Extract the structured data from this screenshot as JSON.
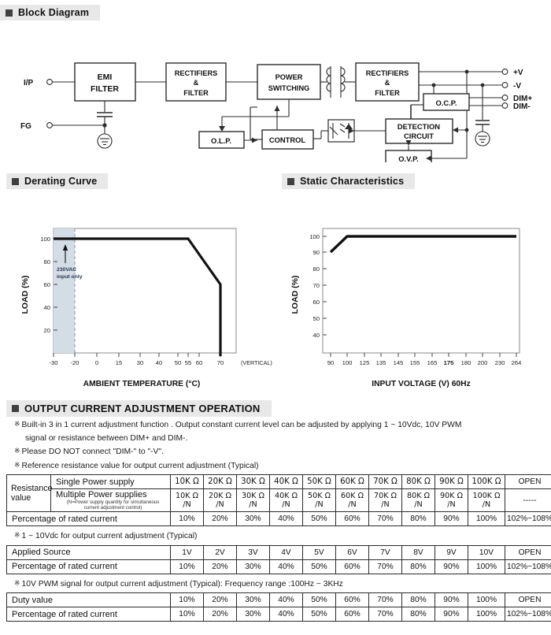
{
  "sections": {
    "block_diagram": {
      "title": "Block Diagram"
    },
    "derating": {
      "title": "Derating Curve"
    },
    "static": {
      "title": "Static Characteristics"
    },
    "adjust": {
      "title": "OUTPUT CURRENT ADJUSTMENT OPERATION"
    }
  },
  "block_diagram": {
    "inputs": [
      "I/P",
      "FG"
    ],
    "blocks": [
      "EMI\nFILTER",
      "RECTIFIERS\n&\nFILTER",
      "POWER\nSWITCHING",
      "RECTIFIERS\n&\nFILTER",
      "O.L.P.",
      "CONTROL",
      "O.C.P.",
      "DETECTION\nCIRCUIT",
      "O.V.P."
    ],
    "block_labels": {
      "emi_filter_l1": "EMI",
      "emi_filter_l2": "FILTER",
      "rect1_l1": "RECTIFIERS",
      "rect1_l2": "&",
      "rect1_l3": "FILTER",
      "power_l1": "POWER",
      "power_l2": "SWITCHING",
      "rect2_l1": "RECTIFIERS",
      "rect2_l2": "&",
      "rect2_l3": "FILTER",
      "olp": "O.L.P.",
      "control": "CONTROL",
      "ocp": "O.C.P.",
      "detect_l1": "DETECTION",
      "detect_l2": "CIRCUIT",
      "ovp": "O.V.P."
    },
    "outputs": [
      "+V",
      "-V",
      "DIM+",
      "DIM-"
    ]
  },
  "chart_data": [
    {
      "type": "line",
      "name": "derating-curve",
      "title": "Derating Curve",
      "xlabel": "AMBIENT TEMPERATURE (°C)",
      "ylabel": "LOAD (%)",
      "xticks": [
        -30,
        -20,
        0,
        15,
        30,
        40,
        50,
        55,
        60,
        70
      ],
      "yticks": [
        20,
        40,
        60,
        80,
        100
      ],
      "xlim": [
        -30,
        75
      ],
      "ylim": [
        0,
        110
      ],
      "grid": false,
      "annotations": [
        {
          "text": "230VAC",
          "x": -26,
          "y": 72
        },
        {
          "text": "input only",
          "x": -26,
          "y": 64
        },
        {
          "text": "(VERTICAL)",
          "x": 78,
          "y": -6
        }
      ],
      "shaded_region": {
        "from": -30,
        "to": -20,
        "color": "#d4dde6"
      },
      "series": [
        {
          "name": "Load vs ambient temperature",
          "points": [
            {
              "x": -30,
              "y": 100
            },
            {
              "x": 55,
              "y": 100
            },
            {
              "x": 70,
              "y": 60
            },
            {
              "x": 70,
              "y": 0
            }
          ]
        }
      ]
    },
    {
      "type": "line",
      "name": "static-characteristics",
      "title": "Static Characteristics",
      "xlabel": "INPUT VOLTAGE (V) 60Hz",
      "ylabel": "LOAD (%)",
      "xticks": [
        90,
        100,
        125,
        135,
        145,
        155,
        165,
        175,
        180,
        200,
        230,
        264
      ],
      "xtick_bold": [
        175
      ],
      "yticks": [
        40,
        50,
        60,
        70,
        80,
        90,
        100
      ],
      "ylim": [
        30,
        108
      ],
      "grid": false,
      "series": [
        {
          "name": "Load vs input voltage",
          "points": [
            {
              "x": 90,
              "y": 90
            },
            {
              "x": 100,
              "y": 100
            },
            {
              "x": 264,
              "y": 100
            }
          ]
        }
      ]
    }
  ],
  "adjust": {
    "notes": [
      "Built-in 3 in 1 current adjustment function .  Output constant current level can be adjusted by applying 1 ~ 10Vdc, 10V PWM",
      "signal or resistance between DIM+ and DIM-.",
      "Please DO NOT connect \"DIM-\" to \"-V\".",
      "Reference resistance value for output current adjustment (Typical)",
      "1 ~ 10Vdc for output current adjustment (Typical)",
      "10V PWM signal for output current adjustment (Typical): Frequency range :100Hz ~ 3KHz"
    ],
    "mark": "※",
    "table_resistance": {
      "row_group_label_l1": "Resistance",
      "row_group_label_l2": "value",
      "row_single_label": "Single Power supply",
      "row_multi_label": "Multiple Power supplies",
      "row_multi_sub_l1": "(N=Power supply quantity for simultaneous",
      "row_multi_sub_l2": "current adjustment control)",
      "row_pct_label": "Percentage of rated current",
      "single_values": [
        "10K Ω",
        "20K Ω",
        "30K Ω",
        "40K Ω",
        "50K Ω",
        "60K Ω",
        "70K Ω",
        "80K Ω",
        "90K Ω",
        "100K Ω",
        "OPEN"
      ],
      "multi_values": [
        "10K Ω /N",
        "20K Ω /N",
        "30K Ω /N",
        "40K Ω /N",
        "50K Ω /N",
        "60K Ω /N",
        "70K Ω /N",
        "80K Ω /N",
        "90K Ω /N",
        "100K Ω /N",
        "-----"
      ],
      "pct_values": [
        "10%",
        "20%",
        "30%",
        "40%",
        "50%",
        "60%",
        "70%",
        "80%",
        "90%",
        "100%",
        "102%~108%"
      ]
    },
    "table_voltage": {
      "row_source_label": "Applied Source",
      "row_pct_label": "Percentage of rated current",
      "source_values": [
        "1V",
        "2V",
        "3V",
        "4V",
        "5V",
        "6V",
        "7V",
        "8V",
        "9V",
        "10V",
        "OPEN"
      ],
      "pct_values": [
        "10%",
        "20%",
        "30%",
        "40%",
        "50%",
        "60%",
        "70%",
        "80%",
        "90%",
        "100%",
        "102%~108%"
      ]
    },
    "table_pwm": {
      "row_duty_label": "Duty value",
      "row_pct_label": "Percentage of rated current",
      "duty_values": [
        "10%",
        "20%",
        "30%",
        "40%",
        "50%",
        "60%",
        "70%",
        "80%",
        "90%",
        "100%",
        "OPEN"
      ],
      "pct_values": [
        "10%",
        "20%",
        "30%",
        "40%",
        "50%",
        "60%",
        "70%",
        "80%",
        "90%",
        "100%",
        "102%~108%"
      ]
    }
  }
}
